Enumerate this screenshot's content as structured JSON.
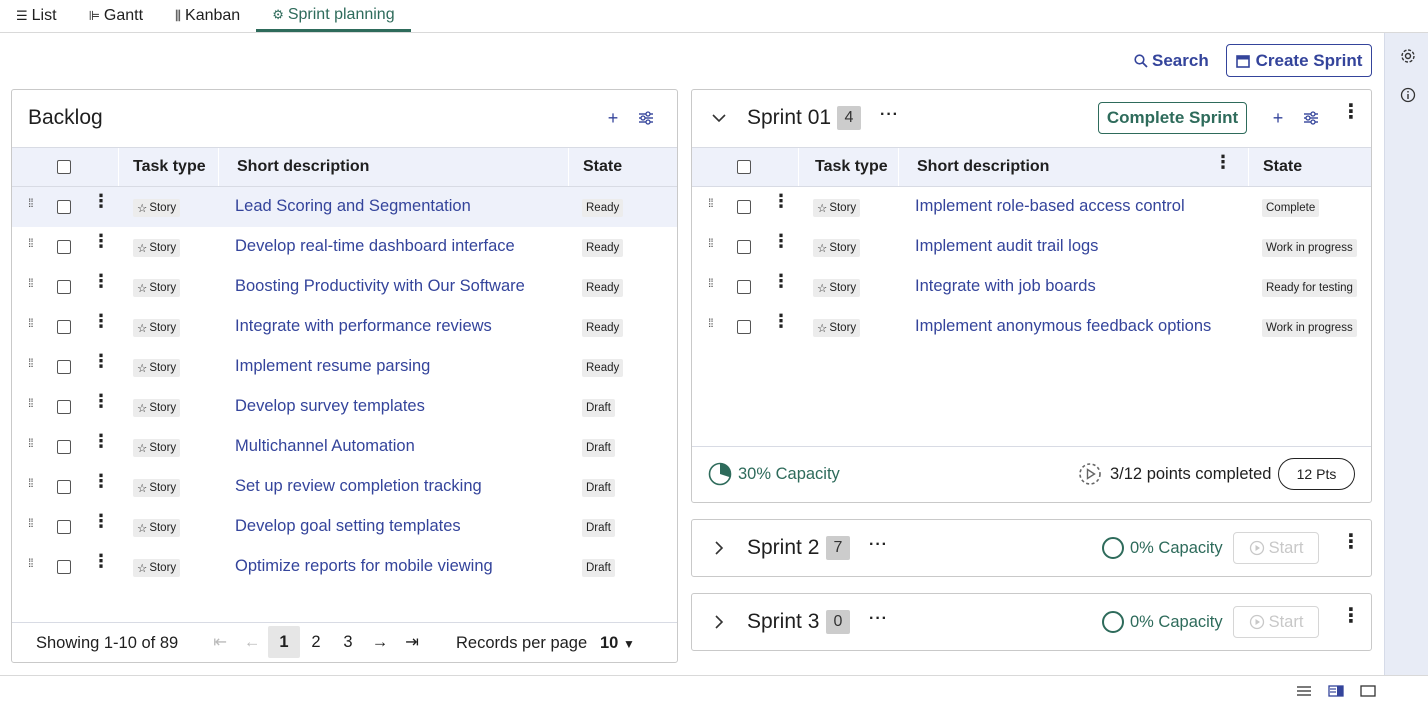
{
  "tabs": [
    {
      "icon": "list-icon",
      "glyph": "☰",
      "label": "List"
    },
    {
      "icon": "gantt-icon",
      "glyph": "⊫",
      "label": "Gantt"
    },
    {
      "icon": "kanban-icon",
      "glyph": "⫼",
      "label": "Kanban"
    },
    {
      "icon": "sprint-icon",
      "glyph": "⚙",
      "label": "Sprint planning"
    }
  ],
  "toolbar": {
    "search_label": "Search",
    "create_label": "Create Sprint"
  },
  "backlog": {
    "title": "Backlog",
    "columns": {
      "task_type": "Task type",
      "short_description": "Short description",
      "state": "State"
    },
    "rows": [
      {
        "type": "Story",
        "desc": "Lead Scoring and Segmentation",
        "state": "Ready"
      },
      {
        "type": "Story",
        "desc": "Develop real-time dashboard interface",
        "state": "Ready"
      },
      {
        "type": "Story",
        "desc": "Boosting Productivity with Our Software",
        "state": "Ready"
      },
      {
        "type": "Story",
        "desc": "Integrate with performance reviews",
        "state": "Ready"
      },
      {
        "type": "Story",
        "desc": "Implement resume parsing",
        "state": "Ready"
      },
      {
        "type": "Story",
        "desc": "Develop survey templates",
        "state": "Draft"
      },
      {
        "type": "Story",
        "desc": "Multichannel Automation",
        "state": "Draft"
      },
      {
        "type": "Story",
        "desc": "Set up review completion tracking",
        "state": "Draft"
      },
      {
        "type": "Story",
        "desc": "Develop goal setting templates",
        "state": "Draft"
      },
      {
        "type": "Story",
        "desc": "Optimize reports for mobile viewing",
        "state": "Draft"
      }
    ],
    "pagination": {
      "showing": "Showing 1-10 of 89",
      "pages": [
        "1",
        "2",
        "3"
      ],
      "records_label": "Records per page",
      "records_value": "10"
    }
  },
  "sprint1": {
    "title": "Sprint 01",
    "count": "4",
    "complete_label": "Complete Sprint",
    "columns": {
      "task_type": "Task type",
      "short_description": "Short description",
      "state": "State"
    },
    "rows": [
      {
        "type": "Story",
        "desc": "Implement role-based access control",
        "state": "Complete"
      },
      {
        "type": "Story",
        "desc": "Implement audit trail logs",
        "state": "Work in progress"
      },
      {
        "type": "Story",
        "desc": "Integrate with job boards",
        "state": "Ready for testing"
      },
      {
        "type": "Story",
        "desc": "Implement anonymous feedback options",
        "state": "Work in progress"
      }
    ],
    "capacity": "30% Capacity",
    "capacity_fraction": 0.3,
    "points": "3/12 points completed",
    "pts_badge": "12 Pts"
  },
  "sprint2": {
    "title": "Sprint 2",
    "count": "7",
    "capacity": "0% Capacity",
    "start_label": "Start"
  },
  "sprint3": {
    "title": "Sprint 3",
    "count": "0",
    "capacity": "0% Capacity",
    "start_label": "Start"
  },
  "colors": {
    "accent": "#34449b",
    "green": "#2e6b5b",
    "header_bg": "#eef1fa",
    "rail": "#e8ecf6"
  }
}
